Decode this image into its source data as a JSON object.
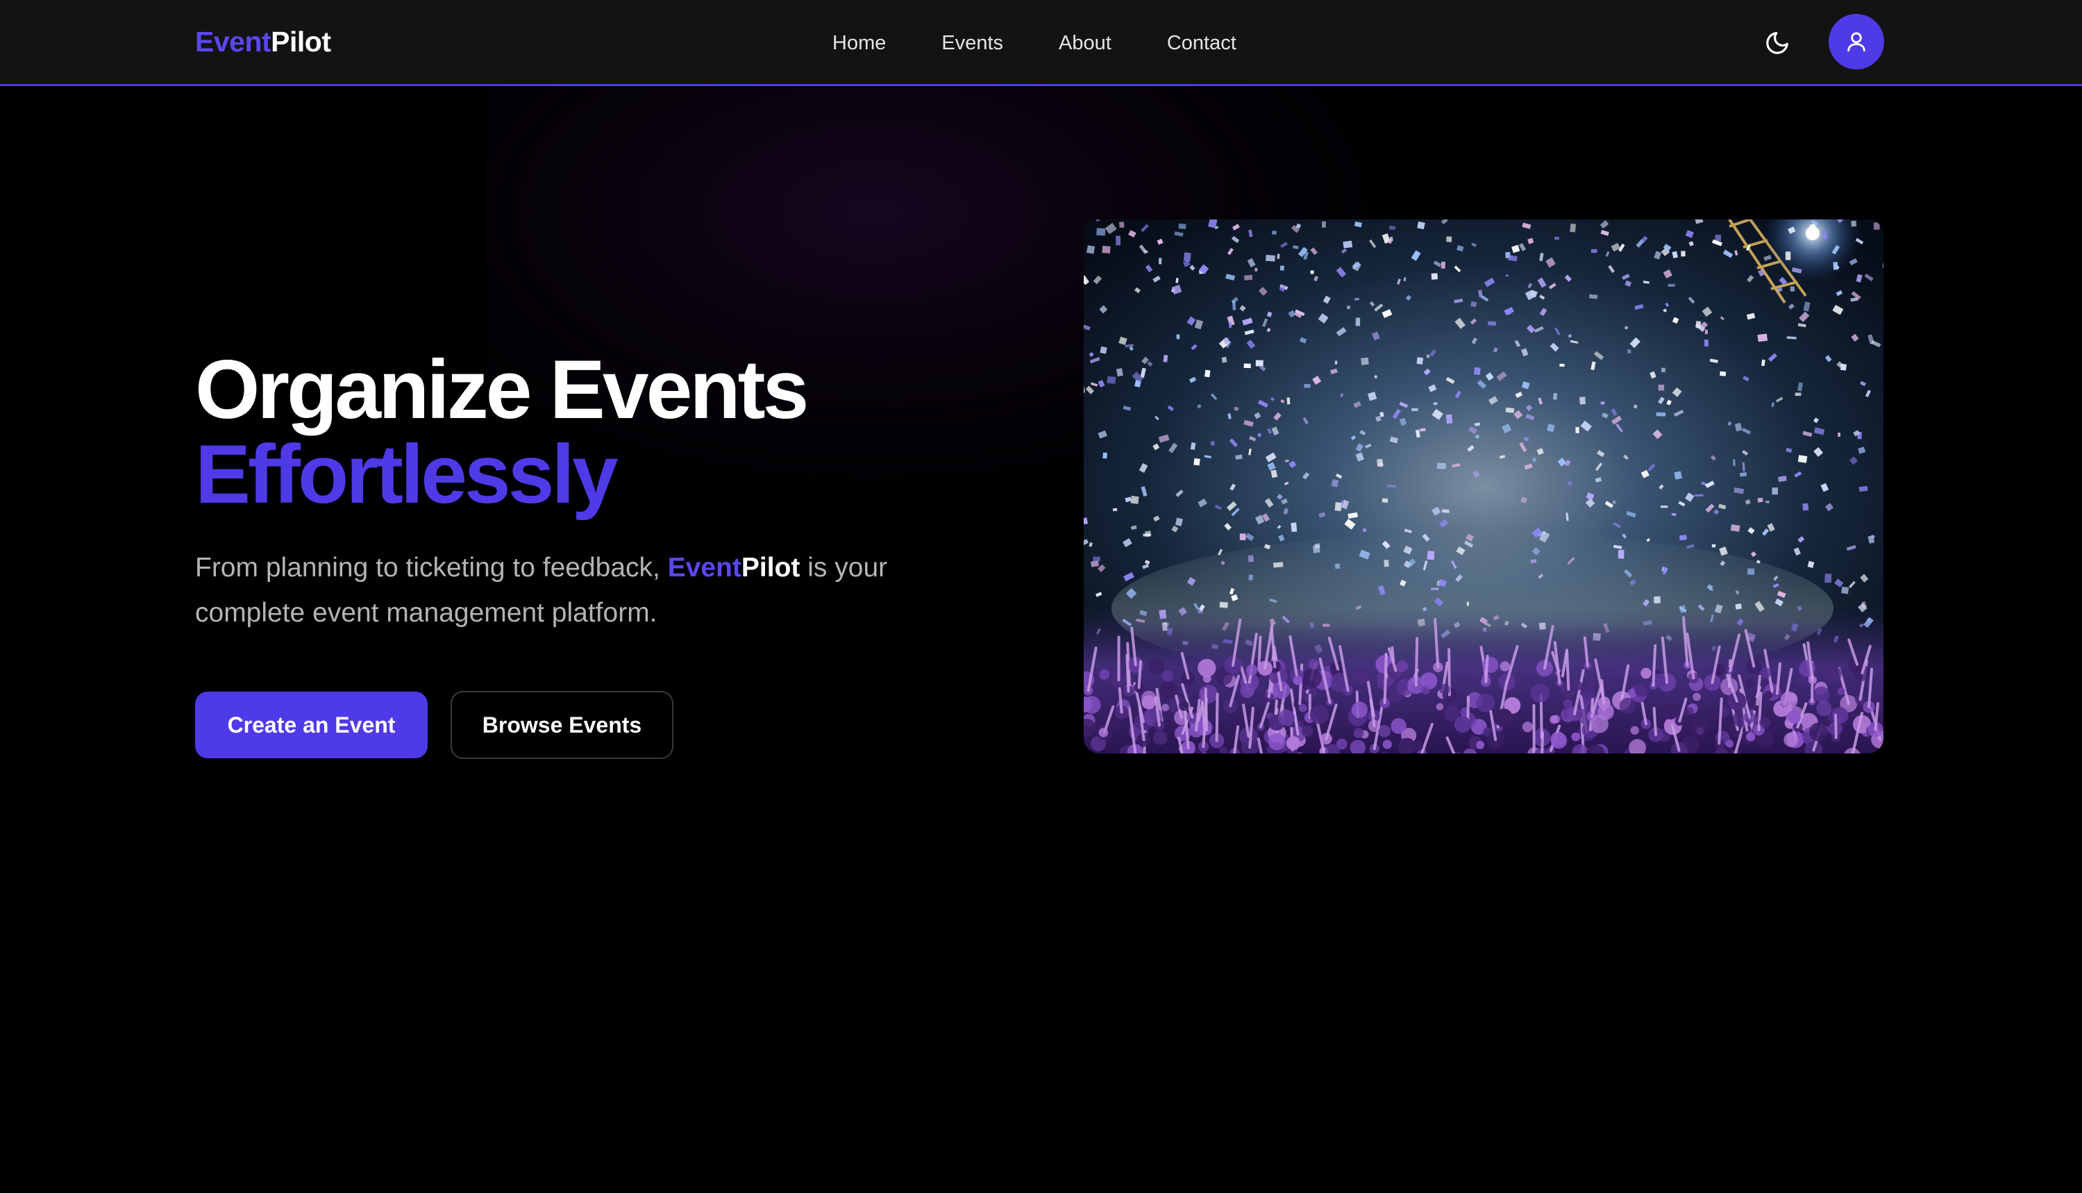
{
  "header": {
    "brand": {
      "accent": "Event",
      "plain": "Pilot"
    },
    "nav": [
      {
        "label": "Home"
      },
      {
        "label": "Events"
      },
      {
        "label": "About"
      },
      {
        "label": "Contact"
      }
    ],
    "theme_toggle_icon": "moon-icon",
    "profile_icon": "user-icon"
  },
  "hero": {
    "title_line1": "Organize Events",
    "title_line2": "Effortlessly",
    "description_before": "From planning to ticketing to feedback, ",
    "description_brand_accent": "Event",
    "description_brand_plain": "Pilot",
    "description_after": " is your complete event management platform.",
    "primary_button": "Create an Event",
    "secondary_button": "Browse Events",
    "image_description": "Concert crowd with confetti under stage lights"
  },
  "colors": {
    "accent": "#4f3ae8",
    "background": "#000000",
    "navbar": "#131313",
    "text_muted": "#b4b4b4"
  }
}
